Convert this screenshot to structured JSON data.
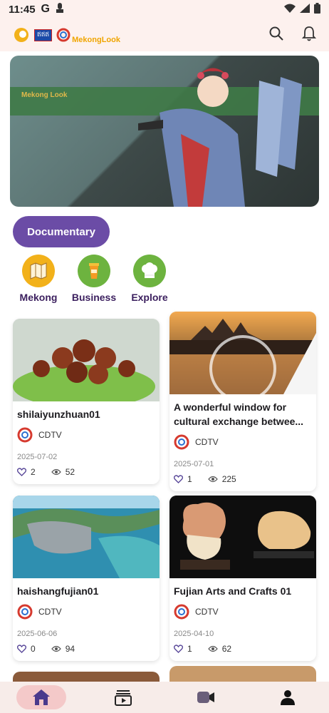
{
  "status": {
    "time": "11:45",
    "g_label": "G"
  },
  "header": {
    "logo_text": "MekongLook",
    "logo_badge": "ឥឥឥ"
  },
  "banner": {
    "brand": "Mekong Look"
  },
  "filter_chip": "Documentary",
  "categories": [
    {
      "label": "Mekong",
      "icon": "map-icon",
      "color": "#f2b11a"
    },
    {
      "label": "Business",
      "icon": "cup-icon",
      "color": "#6db33f"
    },
    {
      "label": "Explore",
      "icon": "chef-hat-icon",
      "color": "#6db33f"
    }
  ],
  "cards": [
    {
      "title": "shilaiyunzhuan01",
      "source": "CDTV",
      "date": "2025-07-02",
      "likes": "2",
      "views": "52"
    },
    {
      "title": "A wonderful window for cultural exchange betwee...",
      "source": "CDTV",
      "date": "2025-07-01",
      "likes": "1",
      "views": "225"
    },
    {
      "title": "haishangfujian01",
      "source": "CDTV",
      "date": "2025-06-06",
      "likes": "0",
      "views": "94"
    },
    {
      "title": "Fujian Arts and Crafts 01",
      "source": "CDTV",
      "date": "2025-04-10",
      "likes": "1",
      "views": "62"
    }
  ],
  "nav": [
    {
      "icon": "home-icon",
      "active": true
    },
    {
      "icon": "video-list-icon",
      "active": false
    },
    {
      "icon": "camera-icon",
      "active": false
    },
    {
      "icon": "profile-icon",
      "active": false
    }
  ],
  "colors": {
    "accent": "#6b4ca6",
    "background_top": "#fdf1ee",
    "nav_active": "#f4c9c9",
    "nav_icon": "#4a3a8c"
  }
}
